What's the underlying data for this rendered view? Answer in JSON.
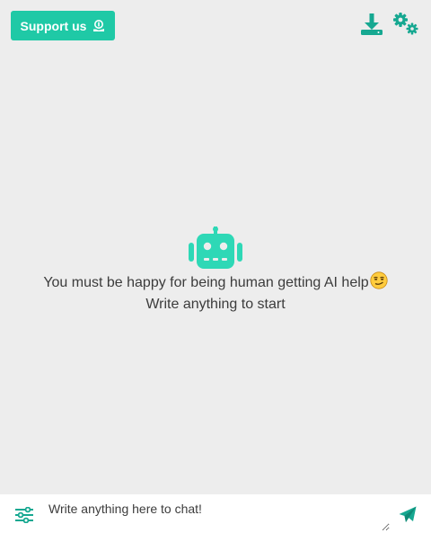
{
  "header": {
    "support_label": "Support us"
  },
  "icons": {
    "support": "hand-coin-icon",
    "download": "download-icon",
    "settings": "settings-gears-icon",
    "robot": "robot-icon",
    "emoji": "smirking-face-emoji",
    "filter": "sliders-icon",
    "send": "send-icon"
  },
  "welcome": {
    "line1": "You must be happy for being human getting AI help",
    "line2": "Write anything to start"
  },
  "chat": {
    "placeholder": "Write anything here to chat!"
  },
  "colors": {
    "accent": "#1fc9a6",
    "icon": "#16a891",
    "background": "#ededed"
  }
}
